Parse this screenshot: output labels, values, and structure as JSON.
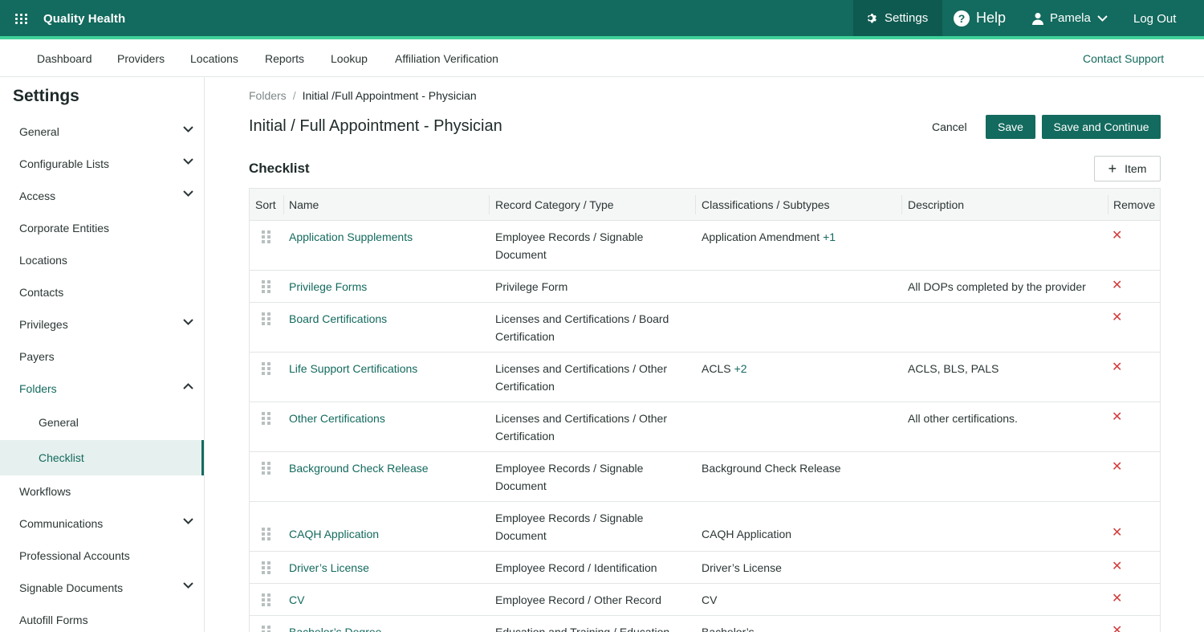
{
  "topbar": {
    "brand": "Quality Health",
    "settings_label": "Settings",
    "help_label": "Help",
    "user_name": "Pamela",
    "logout_label": "Log Out"
  },
  "subnav": {
    "items": [
      "Dashboard",
      "Providers",
      "Locations",
      "Reports",
      "Lookup",
      "Affiliation Verification"
    ],
    "support_label": "Contact Support"
  },
  "sidebar": {
    "title": "Settings",
    "items": [
      {
        "label": "General",
        "expandable": true
      },
      {
        "label": "Configurable Lists",
        "expandable": true
      },
      {
        "label": "Access",
        "expandable": true
      },
      {
        "label": "Corporate Entities"
      },
      {
        "label": "Locations"
      },
      {
        "label": "Contacts"
      },
      {
        "label": "Privileges",
        "expandable": true
      },
      {
        "label": "Payers"
      },
      {
        "label": "Folders",
        "expanded": true
      },
      {
        "label": "General"
      },
      {
        "label": "Checklist"
      },
      {
        "label": "Workflows"
      },
      {
        "label": "Communications",
        "expandable": true
      },
      {
        "label": "Professional Accounts"
      },
      {
        "label": "Signable Documents",
        "expandable": true
      },
      {
        "label": "Autofill Forms"
      }
    ]
  },
  "breadcrumb": {
    "parent": "Folders",
    "separator": "/",
    "current": "Initial /Full Appointment - Physician"
  },
  "page": {
    "title": "Initial / Full Appointment - Physician",
    "cancel_label": "Cancel",
    "save_label": "Save",
    "save_continue_label": "Save and Continue"
  },
  "checklist": {
    "title": "Checklist",
    "add_item_label": "Item",
    "columns": [
      "Sort",
      "Name",
      "Record Category / Type",
      "Classifications / Subtypes",
      "Description",
      "Remove"
    ],
    "rows": [
      {
        "name": "Application Supplements",
        "category": "Employee Records / Signable Document",
        "classification": "Application Amendment",
        "more": "+1",
        "description": ""
      },
      {
        "name": "Privilege Forms",
        "category": "Privilege Form",
        "classification": "",
        "more": "",
        "description": "All DOPs completed by the provider"
      },
      {
        "name": "Board Certifications",
        "category": "Licenses and Certifications / Board Certification",
        "classification": "",
        "more": "",
        "description": ""
      },
      {
        "name": "Life Support Certifications",
        "category": "Licenses and Certifications / Other Certification",
        "classification": "ACLS",
        "more": "+2",
        "description": "ACLS, BLS, PALS"
      },
      {
        "name": "Other Certifications",
        "category": "Licenses and Certifications / Other Certification",
        "classification": "",
        "more": "",
        "description": "All other certifications."
      },
      {
        "name": "Background Check Release",
        "category": "Employee Records / Signable Document",
        "classification": "Background Check Release",
        "more": "",
        "description": ""
      },
      {
        "name": "CAQH Application",
        "category": "Employee Records / Signable Document",
        "classification": "CAQH Application",
        "more": "",
        "description": ""
      },
      {
        "name": "Driver’s License",
        "category": "Employee Record / Identification",
        "classification": "Driver’s License",
        "more": "",
        "description": ""
      },
      {
        "name": "CV",
        "category": "Employee Record / Other Record",
        "classification": "CV",
        "more": "",
        "description": ""
      },
      {
        "name": "Bachelor’s Degree",
        "category": "Education and Training / Education",
        "classification": "Bachelor’s",
        "more": "",
        "description": ""
      }
    ],
    "remove_symbol": "✕"
  },
  "colors": {
    "brand": "#136a5e",
    "accent": "#3ed19a",
    "remove": "#d23b3b"
  }
}
